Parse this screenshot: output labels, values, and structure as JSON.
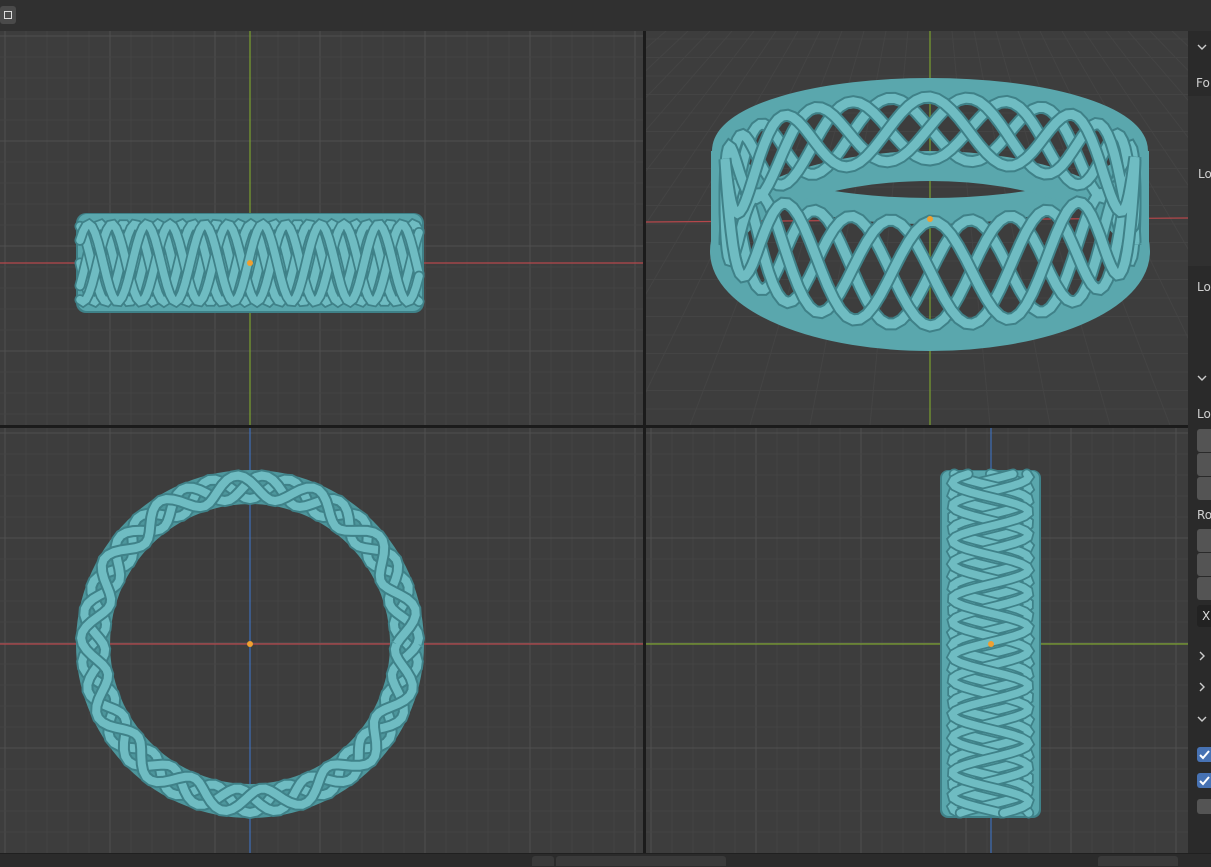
{
  "colors": {
    "viewport_bg": "#3d3d3d",
    "grid_minor": "#444444",
    "grid_major": "#505050",
    "axis_x": "#b5474b",
    "axis_y": "#7aa02e",
    "axis_z": "#3e6fb8",
    "object": "#6fbcc2",
    "object_shadow": "#3f8188",
    "origin": "#f0a030",
    "accent": "#4772b3"
  },
  "toolbar": {
    "mode_icon": "select-box-icon"
  },
  "viewports": [
    {
      "id": "front",
      "view": "front"
    },
    {
      "id": "user-perspective",
      "view": "perspective"
    },
    {
      "id": "top",
      "view": "top"
    },
    {
      "id": "right",
      "view": "right"
    }
  ],
  "sidebar": {
    "label_fo": "Fo",
    "label_lo_1": "Lo",
    "label_lo_2": "Lo",
    "label_lo_3": "Lo",
    "label_ro": "Ro",
    "x_button": "X",
    "checkbox_1": true,
    "checkbox_2": true,
    "checkbox_3": false
  }
}
